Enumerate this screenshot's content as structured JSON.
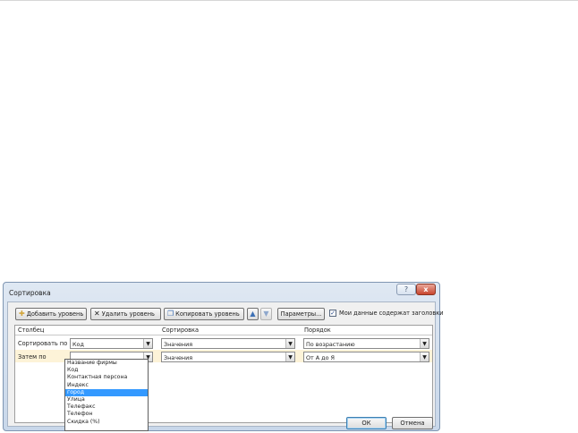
{
  "dialog": {
    "title": "Сортировка",
    "help_glyph": "?",
    "close_glyph": "x"
  },
  "toolbar": {
    "add_level": "Добавить уровень",
    "delete_level": "Удалить уровень",
    "copy_level": "Копировать уровень",
    "options": "Параметры...",
    "headers_checkbox_label": "Мои данные содержат заголовки",
    "headers_checked": true
  },
  "grid": {
    "headers": {
      "column": "Столбец",
      "sort_on": "Сортировка",
      "order": "Порядок"
    },
    "rows": [
      {
        "label": "Сортировать по",
        "column": "Код",
        "sort_on": "Значения",
        "order": "По возрастанию"
      },
      {
        "label": "Затем по",
        "column": "",
        "sort_on": "Значения",
        "order": "От А до Я"
      }
    ]
  },
  "dropdown": {
    "options": [
      "Название фирмы",
      "Код",
      "Контактная персона",
      "Индекс",
      "город",
      "Улица",
      "Телефакс",
      "Телефон",
      "Скидка (%)"
    ],
    "selected": "город"
  },
  "buttons": {
    "ok": "ОК",
    "cancel": "Отмена"
  }
}
